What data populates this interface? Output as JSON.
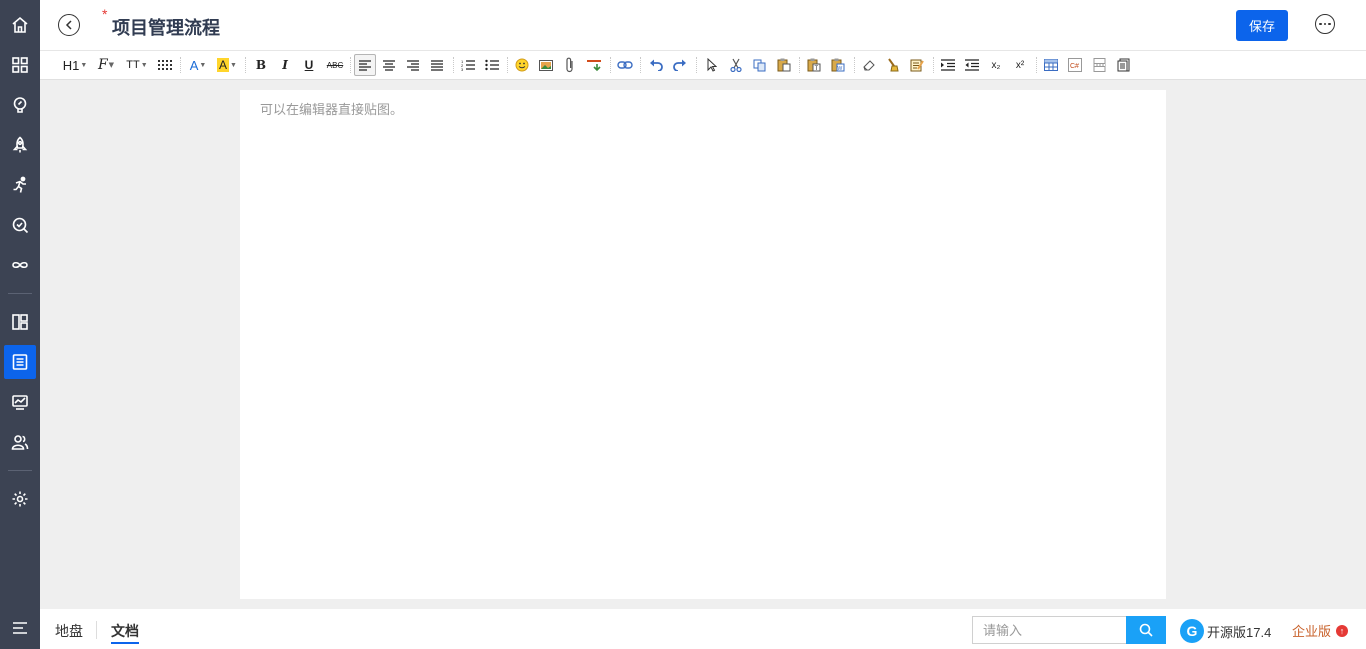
{
  "header": {
    "title": "项目管理流程",
    "required_mark": "*",
    "save_label": "保存"
  },
  "toolbar": {
    "heading_label": "H1",
    "font_family_glyph": "F",
    "font_size_glyph": "TT",
    "bold": "B",
    "italic": "I",
    "underline": "U",
    "strikethrough": "ABC",
    "font_color_glyph": "A",
    "bg_color_glyph": "A",
    "subscript": "x₂",
    "superscript": "x²"
  },
  "editor": {
    "placeholder": "可以在编辑器直接贴图。"
  },
  "footer": {
    "tabs": [
      {
        "label": "地盘"
      },
      {
        "label": "文档"
      }
    ],
    "search_placeholder": "请输入",
    "brand_version": "开源版17.4",
    "enterprise_label": "企业版"
  },
  "sidebar": {
    "active_item": "doc"
  },
  "colors": {
    "accent": "#0c64eb",
    "sidebar": "#3c4353",
    "search_button": "#1aa1f7",
    "enterprise": "#c9622b"
  }
}
